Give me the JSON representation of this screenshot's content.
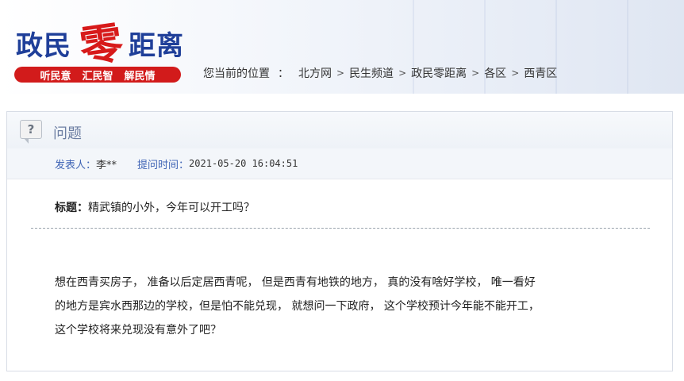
{
  "header": {
    "logo": {
      "part1": "政民",
      "part2": "零",
      "part3": "距离"
    },
    "slogan": [
      "听民意",
      "汇民智",
      "解民情"
    ],
    "breadcrumb_label": "您当前的位置",
    "breadcrumb_colon": "：",
    "breadcrumb": [
      "北方网",
      "民生频道",
      "政民零距离",
      "各区",
      "西青区"
    ]
  },
  "panel": {
    "icon": "question-icon",
    "title": "问题",
    "poster_label": "发表人：",
    "poster": "李**",
    "time_label": "提问时间：",
    "time": "2021-05-20 16:04:51",
    "subject_label": "标题：",
    "subject": "精武镇的小外，今年可以开工吗？",
    "content_lines": [
      "想在西青买房子， 准备以后定居西青呢， 但是西青有地铁的地方， 真的没有啥好学校， 唯一看好",
      "的地方是宾水西那边的学校，但是怕不能兑现， 就想问一下政府， 这个学校预计今年能不能开工，",
      "这个学校将来兑现没有意外了吧？"
    ]
  },
  "colors": {
    "logo_blue": "#1f3f99",
    "logo_red": "#d71a1a",
    "slogan_bg": "#d21b1b",
    "label_blue": "#3f64b5",
    "panel_title": "#6d7fa3"
  }
}
